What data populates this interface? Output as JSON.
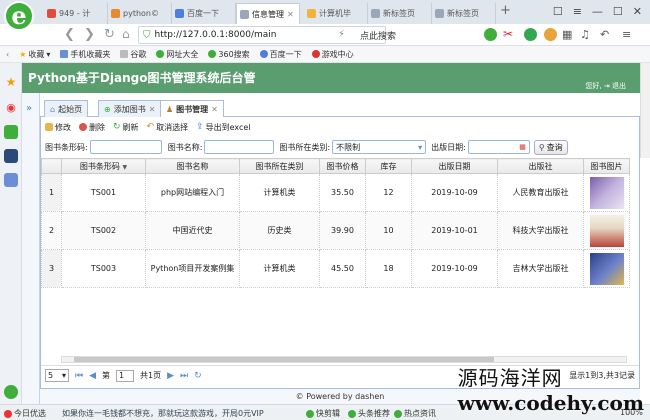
{
  "browser": {
    "tabs": [
      {
        "label": "949 - 计",
        "color": "#e14d3c"
      },
      {
        "label": "python©",
        "color": "#e98a2d"
      },
      {
        "label": "百度一下",
        "color": "#4e7de0"
      },
      {
        "label": "信息管理",
        "color": "#9aa7b8"
      },
      {
        "label": "计算机毕",
        "color": "#f0b43a"
      },
      {
        "label": "新标签页",
        "color": "#9aa7b8"
      },
      {
        "label": "新标签页",
        "color": "#9aa7b8"
      }
    ],
    "new_tab_glyph": "+",
    "url": "http://127.0.0.1:8000/main",
    "search_text": "点此搜索",
    "bookmarks": [
      "收藏",
      "手机收藏夹",
      "谷歌",
      "网址大全",
      "360搜索",
      "百度一下",
      "游戏中心"
    ],
    "status_left": "今日优选",
    "status_news": "如果你连一毛钱都不想充，那就玩这款游戏，开局0元VIP",
    "status_right": [
      "快剪辑",
      "头条推荐",
      "热点资讯"
    ],
    "zoom": "100%"
  },
  "app": {
    "title": "Python基于Django图书管理系统后台管",
    "welcome": "您好,",
    "logout": "退出",
    "tabs": [
      {
        "label": "起始页",
        "active": false,
        "closable": false
      },
      {
        "label": "添加图书",
        "active": false,
        "closable": true
      },
      {
        "label": "图书管理",
        "active": true,
        "closable": true
      }
    ],
    "toolbar": {
      "edit": "修改",
      "delete": "删除",
      "refresh": "刷新",
      "deselect": "取消选择",
      "export": "导出到excel"
    },
    "search": {
      "barcode_label": "图书条形码:",
      "name_label": "图书名称:",
      "category_label": "图书所在类别:",
      "category_value": "不限制",
      "date_label": "出版日期:",
      "query_button": "查询"
    },
    "table": {
      "columns": [
        "图书条形码",
        "图书名称",
        "图书所在类别",
        "图书价格",
        "库存",
        "出版日期",
        "出版社",
        "图书图片"
      ],
      "rows": [
        {
          "no": "1",
          "barcode": "TS001",
          "name": "php网站编程入门",
          "category": "计算机类",
          "price": "35.50",
          "stock": "12",
          "date": "2019-10-09",
          "publisher": "人民教育出版社"
        },
        {
          "no": "2",
          "barcode": "TS002",
          "name": "中国近代史",
          "category": "历史类",
          "price": "39.90",
          "stock": "10",
          "date": "2019-10-01",
          "publisher": "科技大学出版社"
        },
        {
          "no": "3",
          "barcode": "TS003",
          "name": "Python项目开发案例集",
          "category": "计算机类",
          "price": "45.50",
          "stock": "18",
          "date": "2019-10-09",
          "publisher": "吉林大学出版社"
        }
      ]
    },
    "pager": {
      "page_size": "5",
      "page_prefix": "第",
      "page_value": "1",
      "page_suffix": "共1页",
      "summary": "显示1到3,共3记录"
    },
    "footer": "© Powered by dashen"
  },
  "watermark": {
    "cn": "源码海洋网",
    "url": "www.codehy.com"
  }
}
